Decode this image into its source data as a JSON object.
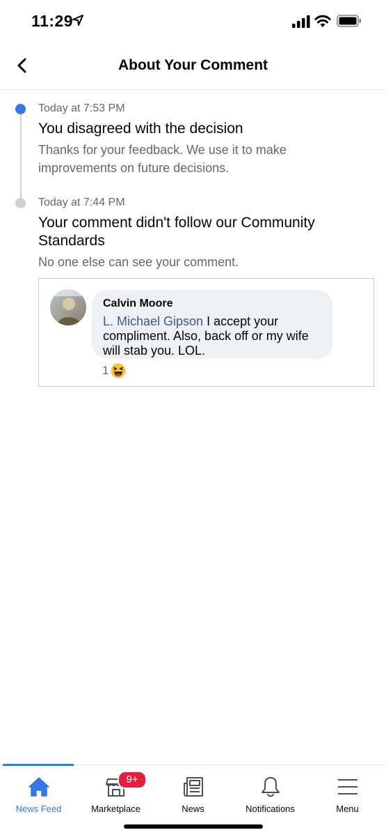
{
  "status_bar": {
    "time": "11:29"
  },
  "header": {
    "title": "About Your Comment"
  },
  "timeline": [
    {
      "time": "Today at 7:53 PM",
      "title": "You disagreed with the decision",
      "description": "Thanks for your feedback. We use it to make improvements on future decisions."
    },
    {
      "time": "Today at 7:44 PM",
      "title": "Your comment didn't follow our Community Standards",
      "description": "No one else can see your comment."
    }
  ],
  "comment": {
    "author": "Calvin Moore",
    "mention": "L. Michael Gipson",
    "text": " I accept your compliment. Also, back off or my wife will stab you. LOL.",
    "reaction_count": "1"
  },
  "tabs": [
    {
      "label": "News Feed",
      "icon": "home-icon",
      "active": true
    },
    {
      "label": "Marketplace",
      "icon": "marketplace-icon",
      "badge": "9+"
    },
    {
      "label": "News",
      "icon": "news-icon"
    },
    {
      "label": "Notifications",
      "icon": "bell-icon"
    },
    {
      "label": "Menu",
      "icon": "hamburger-icon"
    }
  ],
  "colors": {
    "accent": "#3578e5",
    "badge": "#e41e3f",
    "mention": "#385898"
  }
}
